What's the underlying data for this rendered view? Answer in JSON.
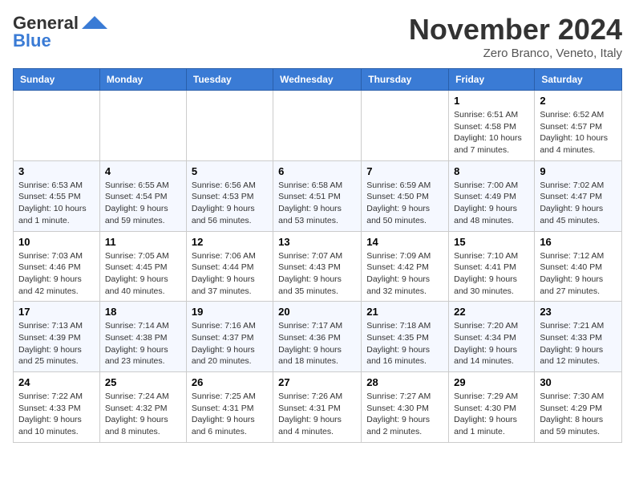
{
  "header": {
    "logo_general": "General",
    "logo_blue": "Blue",
    "month_title": "November 2024",
    "location": "Zero Branco, Veneto, Italy"
  },
  "days_of_week": [
    "Sunday",
    "Monday",
    "Tuesday",
    "Wednesday",
    "Thursday",
    "Friday",
    "Saturday"
  ],
  "weeks": [
    [
      {
        "day": "",
        "info": ""
      },
      {
        "day": "",
        "info": ""
      },
      {
        "day": "",
        "info": ""
      },
      {
        "day": "",
        "info": ""
      },
      {
        "day": "",
        "info": ""
      },
      {
        "day": "1",
        "info": "Sunrise: 6:51 AM\nSunset: 4:58 PM\nDaylight: 10 hours and 7 minutes."
      },
      {
        "day": "2",
        "info": "Sunrise: 6:52 AM\nSunset: 4:57 PM\nDaylight: 10 hours and 4 minutes."
      }
    ],
    [
      {
        "day": "3",
        "info": "Sunrise: 6:53 AM\nSunset: 4:55 PM\nDaylight: 10 hours and 1 minute."
      },
      {
        "day": "4",
        "info": "Sunrise: 6:55 AM\nSunset: 4:54 PM\nDaylight: 9 hours and 59 minutes."
      },
      {
        "day": "5",
        "info": "Sunrise: 6:56 AM\nSunset: 4:53 PM\nDaylight: 9 hours and 56 minutes."
      },
      {
        "day": "6",
        "info": "Sunrise: 6:58 AM\nSunset: 4:51 PM\nDaylight: 9 hours and 53 minutes."
      },
      {
        "day": "7",
        "info": "Sunrise: 6:59 AM\nSunset: 4:50 PM\nDaylight: 9 hours and 50 minutes."
      },
      {
        "day": "8",
        "info": "Sunrise: 7:00 AM\nSunset: 4:49 PM\nDaylight: 9 hours and 48 minutes."
      },
      {
        "day": "9",
        "info": "Sunrise: 7:02 AM\nSunset: 4:47 PM\nDaylight: 9 hours and 45 minutes."
      }
    ],
    [
      {
        "day": "10",
        "info": "Sunrise: 7:03 AM\nSunset: 4:46 PM\nDaylight: 9 hours and 42 minutes."
      },
      {
        "day": "11",
        "info": "Sunrise: 7:05 AM\nSunset: 4:45 PM\nDaylight: 9 hours and 40 minutes."
      },
      {
        "day": "12",
        "info": "Sunrise: 7:06 AM\nSunset: 4:44 PM\nDaylight: 9 hours and 37 minutes."
      },
      {
        "day": "13",
        "info": "Sunrise: 7:07 AM\nSunset: 4:43 PM\nDaylight: 9 hours and 35 minutes."
      },
      {
        "day": "14",
        "info": "Sunrise: 7:09 AM\nSunset: 4:42 PM\nDaylight: 9 hours and 32 minutes."
      },
      {
        "day": "15",
        "info": "Sunrise: 7:10 AM\nSunset: 4:41 PM\nDaylight: 9 hours and 30 minutes."
      },
      {
        "day": "16",
        "info": "Sunrise: 7:12 AM\nSunset: 4:40 PM\nDaylight: 9 hours and 27 minutes."
      }
    ],
    [
      {
        "day": "17",
        "info": "Sunrise: 7:13 AM\nSunset: 4:39 PM\nDaylight: 9 hours and 25 minutes."
      },
      {
        "day": "18",
        "info": "Sunrise: 7:14 AM\nSunset: 4:38 PM\nDaylight: 9 hours and 23 minutes."
      },
      {
        "day": "19",
        "info": "Sunrise: 7:16 AM\nSunset: 4:37 PM\nDaylight: 9 hours and 20 minutes."
      },
      {
        "day": "20",
        "info": "Sunrise: 7:17 AM\nSunset: 4:36 PM\nDaylight: 9 hours and 18 minutes."
      },
      {
        "day": "21",
        "info": "Sunrise: 7:18 AM\nSunset: 4:35 PM\nDaylight: 9 hours and 16 minutes."
      },
      {
        "day": "22",
        "info": "Sunrise: 7:20 AM\nSunset: 4:34 PM\nDaylight: 9 hours and 14 minutes."
      },
      {
        "day": "23",
        "info": "Sunrise: 7:21 AM\nSunset: 4:33 PM\nDaylight: 9 hours and 12 minutes."
      }
    ],
    [
      {
        "day": "24",
        "info": "Sunrise: 7:22 AM\nSunset: 4:33 PM\nDaylight: 9 hours and 10 minutes."
      },
      {
        "day": "25",
        "info": "Sunrise: 7:24 AM\nSunset: 4:32 PM\nDaylight: 9 hours and 8 minutes."
      },
      {
        "day": "26",
        "info": "Sunrise: 7:25 AM\nSunset: 4:31 PM\nDaylight: 9 hours and 6 minutes."
      },
      {
        "day": "27",
        "info": "Sunrise: 7:26 AM\nSunset: 4:31 PM\nDaylight: 9 hours and 4 minutes."
      },
      {
        "day": "28",
        "info": "Sunrise: 7:27 AM\nSunset: 4:30 PM\nDaylight: 9 hours and 2 minutes."
      },
      {
        "day": "29",
        "info": "Sunrise: 7:29 AM\nSunset: 4:30 PM\nDaylight: 9 hours and 1 minute."
      },
      {
        "day": "30",
        "info": "Sunrise: 7:30 AM\nSunset: 4:29 PM\nDaylight: 8 hours and 59 minutes."
      }
    ]
  ]
}
